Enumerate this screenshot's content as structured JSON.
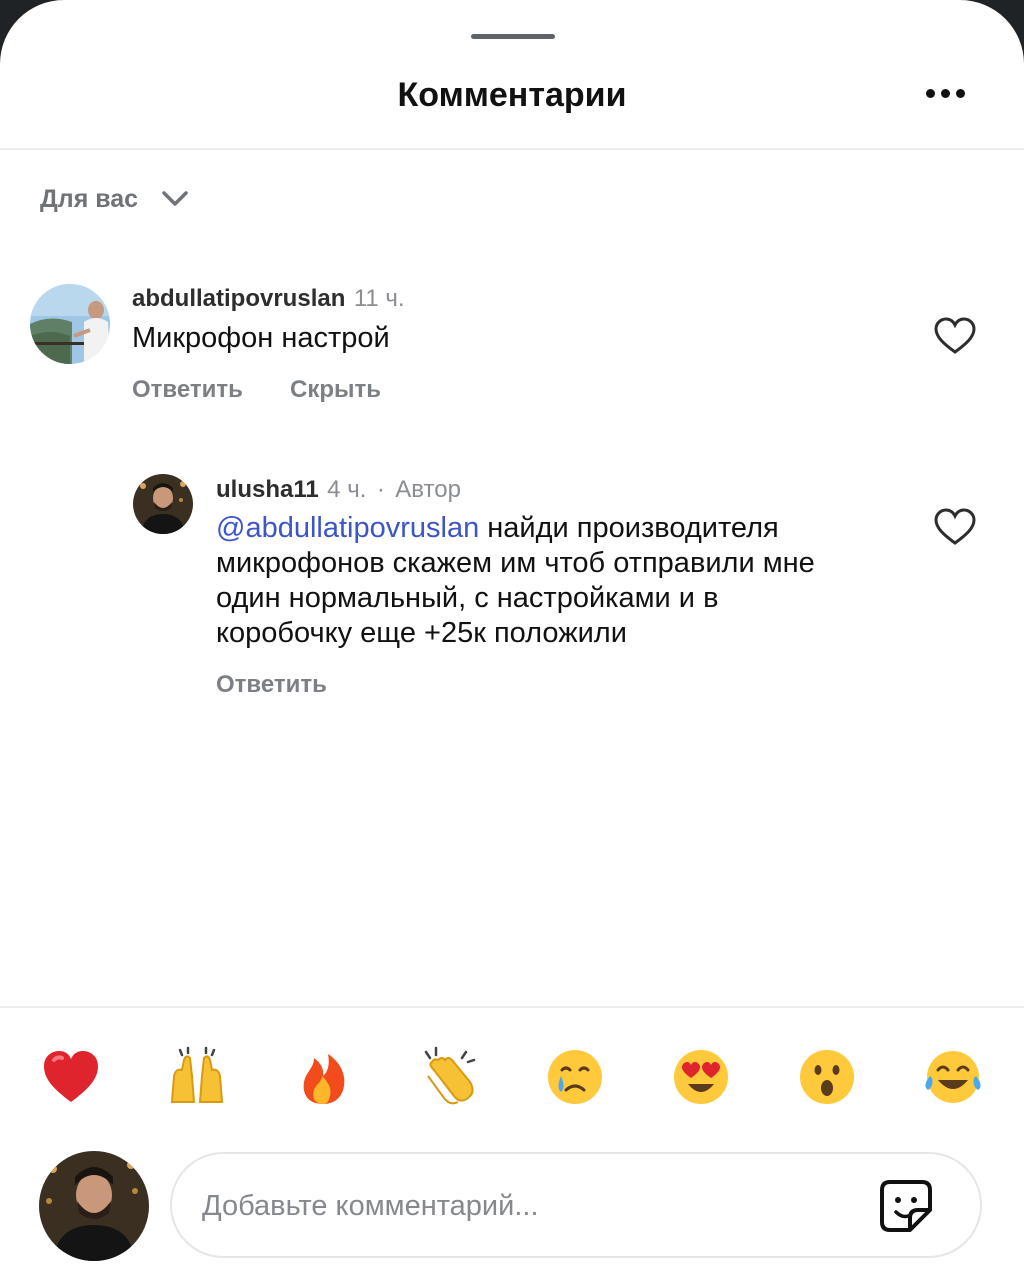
{
  "header": {
    "title": "Комментарии",
    "more_icon": "more-horizontal-icon"
  },
  "filter": {
    "label": "Для вас",
    "icon": "chevron-down-icon"
  },
  "comments": [
    {
      "username": "abdullatipovruslan",
      "time": "11 ч.",
      "text": "Микрофон настрой",
      "actions": [
        "Ответить",
        "Скрыть"
      ],
      "like_icon": "heart-outline-icon"
    },
    {
      "username": "ulusha11",
      "time": "4 ч.",
      "separator": "·",
      "badge": "Автор",
      "mention": "@abdullatipovruslan",
      "text_lines": [
        " найди производителя",
        "микрофонов скажем им чтоб отправили мне",
        "один нормальный, с настройками и в",
        "коробочку еще +25к положили"
      ],
      "actions": [
        "Ответить"
      ],
      "like_icon": "heart-outline-icon"
    }
  ],
  "reactions": [
    "❤️",
    "🙌",
    "🔥",
    "👏",
    "😢",
    "😍",
    "😮",
    "😂"
  ],
  "composer": {
    "placeholder": "Добавьте комментарий...",
    "sticker_icon": "sticker-icon"
  },
  "colors": {
    "mention": "#3c55c9",
    "heart_red": "#e0242e"
  }
}
